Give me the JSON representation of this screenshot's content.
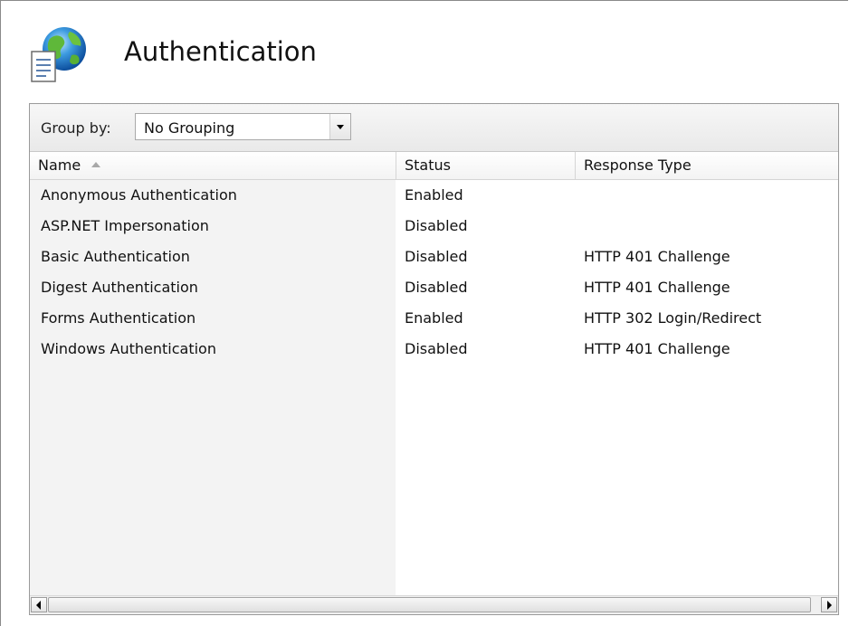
{
  "header": {
    "title": "Authentication",
    "icon": "globe-document-icon"
  },
  "group_bar": {
    "label": "Group by:",
    "selected": "No Grouping"
  },
  "columns": {
    "name": "Name",
    "status": "Status",
    "response_type": "Response Type"
  },
  "rows": [
    {
      "name": "Anonymous Authentication",
      "status": "Enabled",
      "response_type": ""
    },
    {
      "name": "ASP.NET Impersonation",
      "status": "Disabled",
      "response_type": ""
    },
    {
      "name": "Basic Authentication",
      "status": "Disabled",
      "response_type": "HTTP 401 Challenge"
    },
    {
      "name": "Digest Authentication",
      "status": "Disabled",
      "response_type": "HTTP 401 Challenge"
    },
    {
      "name": "Forms Authentication",
      "status": "Enabled",
      "response_type": "HTTP 302 Login/Redirect"
    },
    {
      "name": "Windows Authentication",
      "status": "Disabled",
      "response_type": "HTTP 401 Challenge"
    }
  ]
}
